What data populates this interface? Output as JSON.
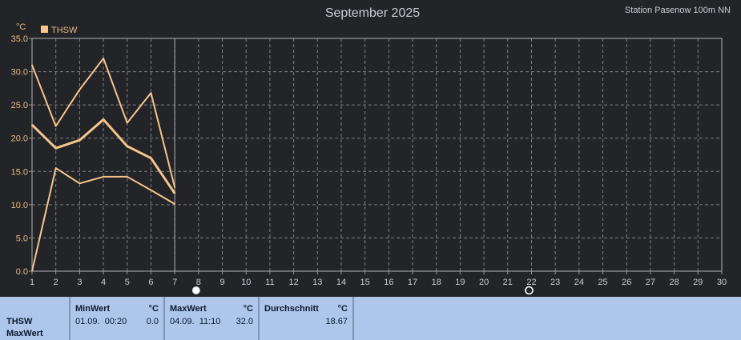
{
  "header": {
    "title": "September 2025",
    "station": "Station Pasenow 100m NN"
  },
  "chart_data": {
    "type": "line",
    "title": "September 2025",
    "ylabel": "°C",
    "legend": "THSW",
    "legend_position": "top-left",
    "grid": true,
    "xlim": [
      1,
      30
    ],
    "ylim": [
      0,
      35
    ],
    "x_ticks": [
      "1",
      "2",
      "3",
      "4",
      "5",
      "6",
      "7",
      "8",
      "9",
      "10",
      "11",
      "12",
      "13",
      "14",
      "15",
      "16",
      "17",
      "18",
      "19",
      "20",
      "21",
      "22",
      "23",
      "24",
      "25",
      "26",
      "27",
      "28",
      "29",
      "30"
    ],
    "y_ticks": [
      "0.0",
      "5.0",
      "10.0",
      "15.0",
      "20.0",
      "25.0",
      "30.0",
      "35.0"
    ],
    "current_day": 7,
    "series": [
      {
        "name": "Max",
        "x": [
          1,
          2,
          3,
          4,
          5,
          6,
          7
        ],
        "values": [
          31.0,
          21.8,
          27.3,
          32.0,
          22.3,
          26.8,
          12.6
        ],
        "width": 2
      },
      {
        "name": "Durchschnitt",
        "x": [
          1,
          2,
          3,
          4,
          5,
          6,
          7
        ],
        "values": [
          22.0,
          18.5,
          19.7,
          22.8,
          18.8,
          17.0,
          11.7
        ],
        "width": 3
      },
      {
        "name": "Min",
        "x": [
          1,
          2,
          3,
          4,
          5,
          6,
          7
        ],
        "values": [
          0.0,
          15.5,
          13.2,
          14.2,
          14.2,
          12.2,
          10.1
        ],
        "width": 2
      }
    ],
    "line_color": "#f6c48c",
    "markers": [
      {
        "day": 7.9,
        "type": "full-moon"
      },
      {
        "day": 21.9,
        "type": "new-moon"
      }
    ]
  },
  "panel": {
    "name_line1": "THSW",
    "name_line2": "MaxWert",
    "min": {
      "label": "MinWert",
      "unit": "°C",
      "datetime": "01.09.  00:20",
      "value": "0.0"
    },
    "max": {
      "label": "MaxWert",
      "unit": "°C",
      "datetime": "04.09.  11:10",
      "value": "32.0"
    },
    "avg": {
      "label": "Durchschnitt",
      "unit": "°C",
      "value": "18.67"
    }
  }
}
